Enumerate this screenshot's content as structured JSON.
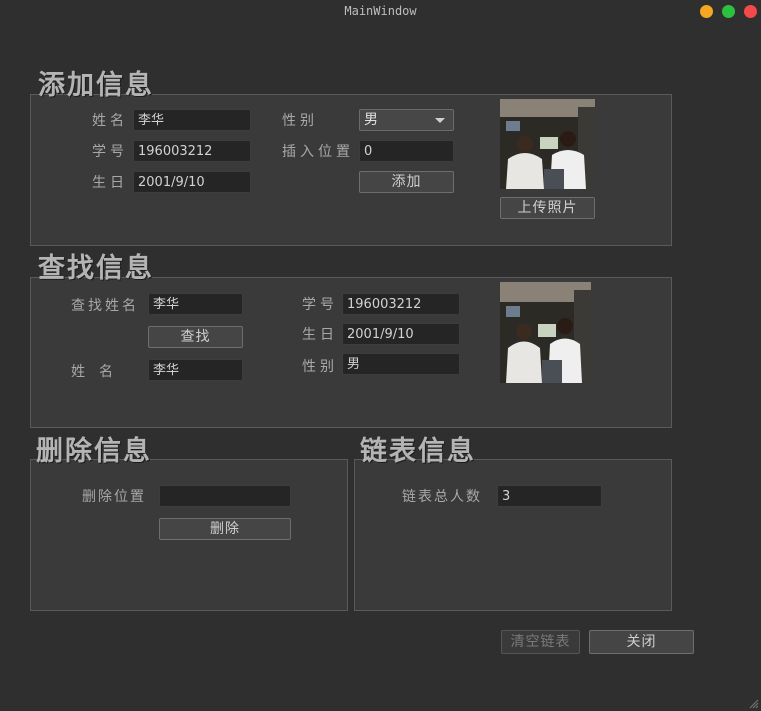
{
  "window": {
    "title": "MainWindow"
  },
  "add": {
    "title": "添加信息",
    "name_label": "姓名",
    "name_value": "李华",
    "id_label": "学号",
    "id_value": "196003212",
    "birth_label": "生日",
    "birth_value": "2001/9/10",
    "gender_label": "性别",
    "gender_value": "男",
    "pos_label": "插入位置",
    "pos_value": "0",
    "add_button": "添加",
    "upload_button": "上传照片"
  },
  "find": {
    "title": "查找信息",
    "search_label": "查找姓名",
    "search_value": "李华",
    "find_button": "查找",
    "name_label": "姓名",
    "name_value": "李华",
    "id_label": "学号",
    "id_value": "196003212",
    "birth_label": "生日",
    "birth_value": "2001/9/10",
    "gender_label": "性别",
    "gender_value": "男"
  },
  "delete": {
    "title": "删除信息",
    "pos_label": "删除位置",
    "pos_value": "",
    "delete_button": "删除"
  },
  "list": {
    "title": "链表信息",
    "count_label": "链表总人数",
    "count_value": "3"
  },
  "footer": {
    "clear_button": "清空链表",
    "close_button": "关闭"
  },
  "colors": {
    "background": "#2f2f2f",
    "group": "#3a3a3a",
    "field": "#252525",
    "min": "#f5a623",
    "max": "#2bc13f",
    "close": "#f24a4a"
  },
  "icons": [
    "minimize-icon",
    "maximize-icon",
    "close-icon",
    "combo-arrow-icon",
    "resize-grip-icon"
  ]
}
